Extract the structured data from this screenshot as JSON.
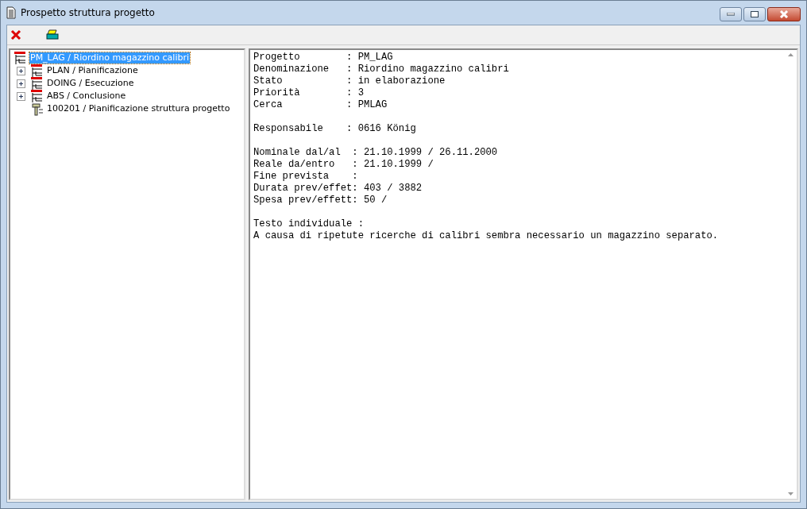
{
  "window": {
    "title": "Prospetto struttura progetto"
  },
  "tree": [
    {
      "label": "PM_LAG / Riordino magazzino calibri",
      "kind": "project",
      "selected": true,
      "children": [
        {
          "label": "PLAN / Pianificazione",
          "kind": "project",
          "selected": false,
          "expanded": false
        },
        {
          "label": "DOING / Esecuzione",
          "kind": "project",
          "selected": false,
          "expanded": false
        },
        {
          "label": "ABS / Conclusione",
          "kind": "project",
          "selected": false,
          "expanded": false
        },
        {
          "label": "100201 / Pianificazione struttura progetto",
          "kind": "activity",
          "selected": false
        }
      ]
    }
  ],
  "details": [
    [
      "Progetto        : PM_LAG",
      "Denominazione   : Riordino magazzino calibri",
      "Stato           : in elaborazione",
      "Priorità        : 3",
      "Cerca           : PMLAG"
    ],
    [
      "Responsabile    : 0616 König"
    ],
    [
      "Nominale dal/al  : 21.10.1999 / 26.11.2000",
      "Reale da/entro   : 21.10.1999 /",
      "Fine prevista    :",
      "Durata prev/effet: 403 / 3882",
      "Spesa prev/effett: 50 /"
    ],
    [
      "Testo individuale :",
      "A causa di ripetute ricerche di calibri sembra necessario un magazzino separato."
    ]
  ]
}
